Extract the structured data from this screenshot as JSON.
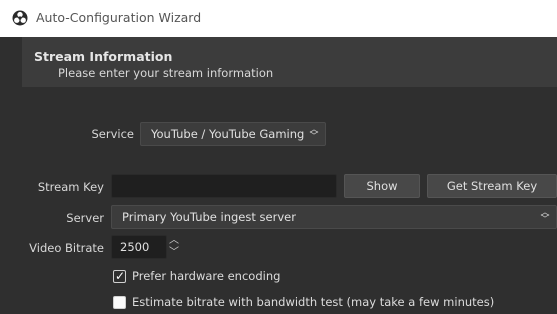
{
  "window": {
    "title": "Auto-Configuration Wizard"
  },
  "header": {
    "title": "Stream Information",
    "subtitle": "Please enter your stream information"
  },
  "form": {
    "service_label": "Service",
    "service_value": "YouTube / YouTube Gaming",
    "stream_key_label": "Stream Key",
    "show_button": "Show",
    "get_stream_key_button": "Get Stream Key",
    "server_label": "Server",
    "server_value": "Primary YouTube ingest server",
    "video_bitrate_label": "Video Bitrate",
    "video_bitrate_value": "2500",
    "prefer_hw_label": "Prefer hardware encoding",
    "prefer_hw_checked": true,
    "estimate_bitrate_label": "Estimate bitrate with bandwidth test (may take a few minutes)",
    "estimate_bitrate_checked": false
  },
  "colors": {
    "background": "#2f2f2f",
    "header_bg": "#3c3c3c",
    "titlebar_bg": "#ffffff"
  }
}
